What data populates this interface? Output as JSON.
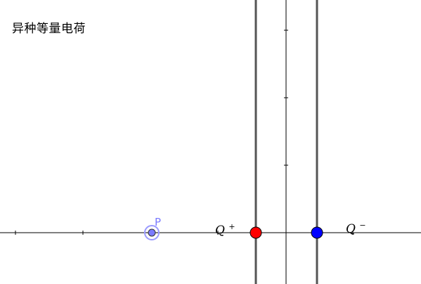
{
  "title": "异种等量电荷",
  "point_label": "P",
  "positive_charge": {
    "symbol": "Q",
    "sign": "+"
  },
  "negative_charge": {
    "symbol": "Q",
    "sign": "−"
  },
  "colors": {
    "positive_charge": "#ff0000",
    "negative_charge": "#0000ff",
    "point": "#7a7aff",
    "point_ring": "#9a9aff",
    "point_label": "#7a7aff",
    "field_line": "#555555",
    "axis": "#000000"
  }
}
